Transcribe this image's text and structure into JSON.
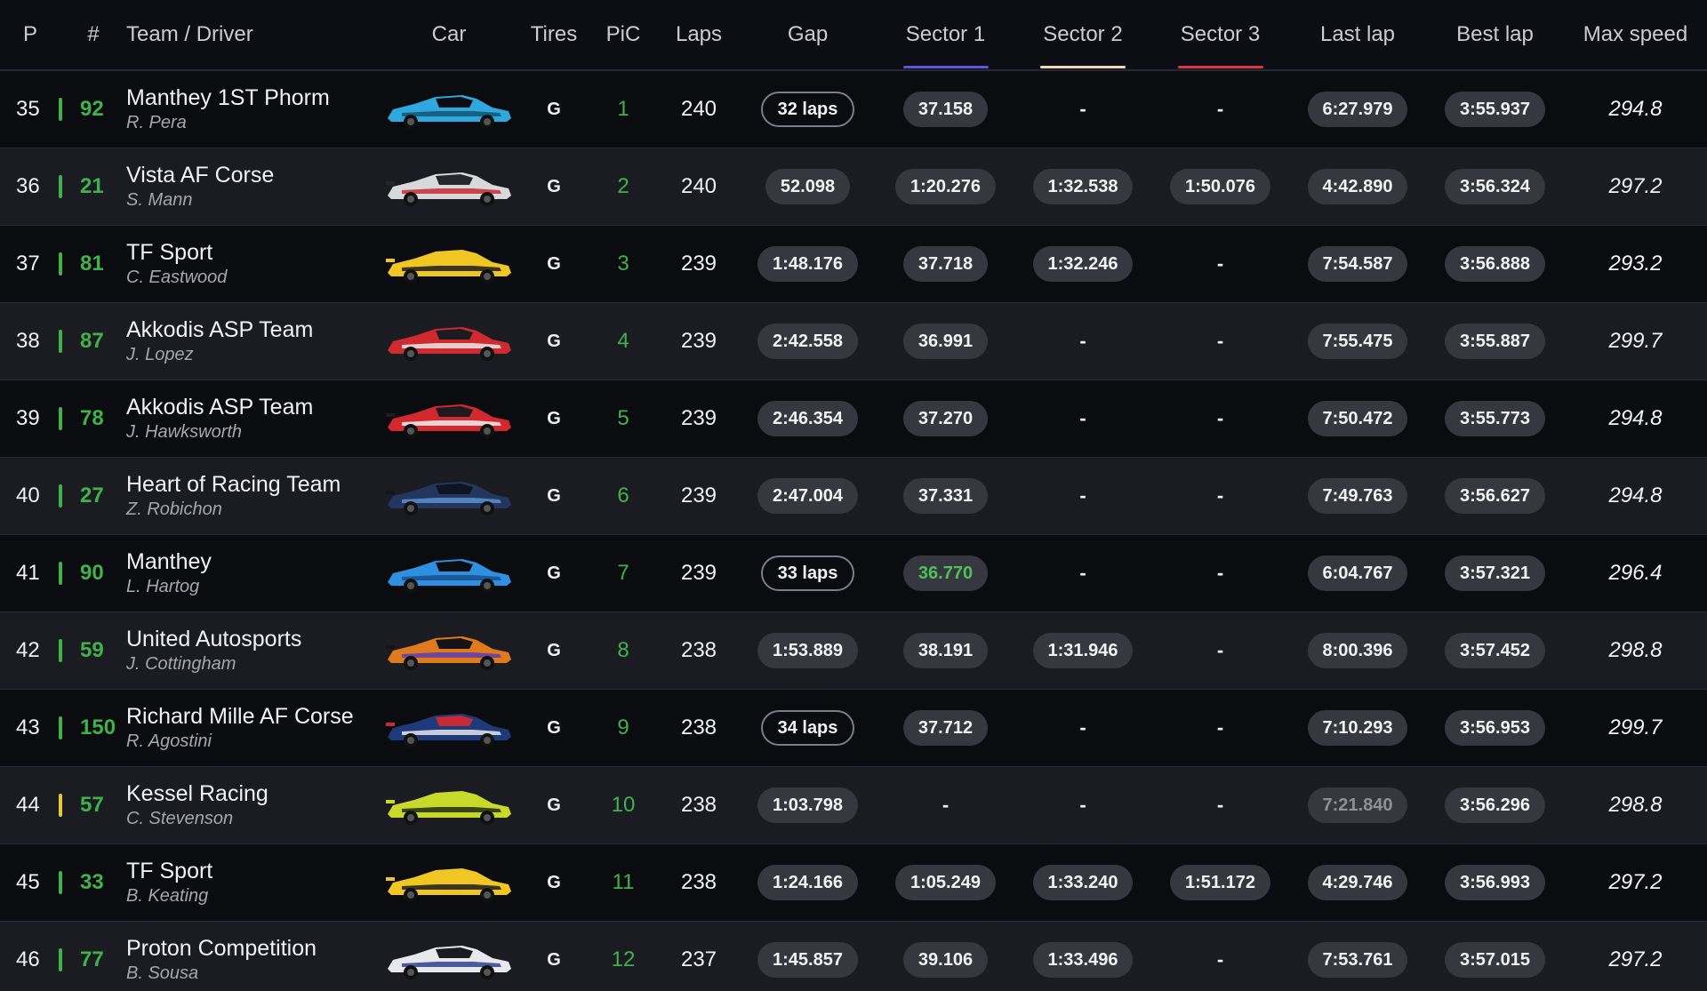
{
  "colors": {
    "sector1": "#5a58e0",
    "sector2": "#f1d5bd",
    "sector3": "#e0344a",
    "class_green": "#3fb24a",
    "class_yellow": "#e8c53a"
  },
  "headers": {
    "pos": "P",
    "num": "#",
    "team": "Team / Driver",
    "car": "Car",
    "tires": "Tires",
    "pic": "PiC",
    "laps": "Laps",
    "gap": "Gap",
    "s1": "Sector 1",
    "s2": "Sector 2",
    "s3": "Sector 3",
    "last": "Last lap",
    "best": "Best lap",
    "max": "Max speed"
  },
  "rows": [
    {
      "pos": "35",
      "num": "92",
      "team": "Manthey 1ST Phorm",
      "driver": "R. Pera",
      "tires": "G",
      "pic": "1",
      "laps": "240",
      "gap": "32 laps",
      "gap_style": "outline",
      "s1": "37.158",
      "s1_style": "pill",
      "s2": "-",
      "s2_style": "dash",
      "s3": "-",
      "s3_style": "dash",
      "last": "6:27.979",
      "last_style": "pill",
      "best": "3:55.937",
      "max": "294.8",
      "class_color": "green",
      "car_colors": [
        "#2fa8e0",
        "#14546e",
        "#0c0d12"
      ]
    },
    {
      "pos": "36",
      "num": "21",
      "team": "Vista AF Corse",
      "driver": "S. Mann",
      "tires": "G",
      "pic": "2",
      "laps": "240",
      "gap": "52.098",
      "gap_style": "pill",
      "s1": "1:20.276",
      "s1_style": "pill",
      "s2": "1:32.538",
      "s2_style": "pill",
      "s3": "1:50.076",
      "s3_style": "pill",
      "last": "4:42.890",
      "last_style": "pill",
      "best": "3:56.324",
      "max": "297.2",
      "class_color": "green",
      "car_colors": [
        "#d9d9dc",
        "#c62a34",
        "#26272c"
      ]
    },
    {
      "pos": "37",
      "num": "81",
      "team": "TF Sport",
      "driver": "C. Eastwood",
      "tires": "G",
      "pic": "3",
      "laps": "239",
      "gap": "1:48.176",
      "gap_style": "pill",
      "s1": "37.718",
      "s1_style": "pill",
      "s2": "1:32.246",
      "s2_style": "pill",
      "s3": "-",
      "s3_style": "dash",
      "last": "7:54.587",
      "last_style": "pill",
      "best": "3:56.888",
      "max": "293.2",
      "class_color": "green",
      "car_colors": [
        "#f0c623",
        "#1b1b1e",
        "#f0c623"
      ]
    },
    {
      "pos": "38",
      "num": "87",
      "team": "Akkodis ASP Team",
      "driver": "J. Lopez",
      "tires": "G",
      "pic": "4",
      "laps": "239",
      "gap": "2:42.558",
      "gap_style": "pill",
      "s1": "36.991",
      "s1_style": "pill",
      "s2": "-",
      "s2_style": "dash",
      "s3": "-",
      "s3_style": "dash",
      "last": "7:55.475",
      "last_style": "pill",
      "best": "3:55.887",
      "max": "299.7",
      "class_color": "green",
      "car_colors": [
        "#cf2a30",
        "#eaeaea",
        "#1c1c20"
      ]
    },
    {
      "pos": "39",
      "num": "78",
      "team": "Akkodis ASP Team",
      "driver": "J. Hawksworth",
      "tires": "G",
      "pic": "5",
      "laps": "239",
      "gap": "2:46.354",
      "gap_style": "pill",
      "s1": "37.270",
      "s1_style": "pill",
      "s2": "-",
      "s2_style": "dash",
      "s3": "-",
      "s3_style": "dash",
      "last": "7:50.472",
      "last_style": "pill",
      "best": "3:55.773",
      "max": "294.8",
      "class_color": "green",
      "car_colors": [
        "#d2282e",
        "#f0f0f0",
        "#1c1c20"
      ]
    },
    {
      "pos": "40",
      "num": "27",
      "team": "Heart of Racing Team",
      "driver": "Z. Robichon",
      "tires": "G",
      "pic": "6",
      "laps": "239",
      "gap": "2:47.004",
      "gap_style": "pill",
      "s1": "37.331",
      "s1_style": "pill",
      "s2": "-",
      "s2_style": "dash",
      "s3": "-",
      "s3_style": "dash",
      "last": "7:49.763",
      "last_style": "pill",
      "best": "3:56.627",
      "max": "294.8",
      "class_color": "green",
      "car_colors": [
        "#23365e",
        "#5a8fd1",
        "#0f1424"
      ]
    },
    {
      "pos": "41",
      "num": "90",
      "team": "Manthey",
      "driver": "L. Hartog",
      "tires": "G",
      "pic": "7",
      "laps": "239",
      "gap": "33 laps",
      "gap_style": "outline",
      "s1": "36.770",
      "s1_style": "best",
      "s2": "-",
      "s2_style": "dash",
      "s3": "-",
      "s3_style": "dash",
      "last": "6:04.767",
      "last_style": "pill",
      "best": "3:57.321",
      "max": "296.4",
      "class_color": "green",
      "car_colors": [
        "#2f8fe0",
        "#1a4f8c",
        "#0c0d12"
      ]
    },
    {
      "pos": "42",
      "num": "59",
      "team": "United Autosports",
      "driver": "J. Cottingham",
      "tires": "G",
      "pic": "8",
      "laps": "238",
      "gap": "1:53.889",
      "gap_style": "pill",
      "s1": "38.191",
      "s1_style": "pill",
      "s2": "1:31.946",
      "s2_style": "pill",
      "s3": "-",
      "s3_style": "dash",
      "last": "8:00.396",
      "last_style": "pill",
      "best": "3:57.452",
      "max": "298.8",
      "class_color": "green",
      "car_colors": [
        "#e07a1f",
        "#5a3fb0",
        "#141418"
      ]
    },
    {
      "pos": "43",
      "num": "150",
      "team": "Richard Mille AF Corse",
      "driver": "R. Agostini",
      "tires": "G",
      "pic": "9",
      "laps": "238",
      "gap": "34 laps",
      "gap_style": "outline",
      "s1": "37.712",
      "s1_style": "pill",
      "s2": "-",
      "s2_style": "dash",
      "s3": "-",
      "s3_style": "dash",
      "last": "7:10.293",
      "last_style": "pill",
      "best": "3:56.953",
      "max": "299.7",
      "class_color": "green",
      "car_colors": [
        "#1f3a7a",
        "#e8e8ea",
        "#c62a34"
      ]
    },
    {
      "pos": "44",
      "num": "57",
      "team": "Kessel Racing",
      "driver": "C. Stevenson",
      "tires": "G",
      "pic": "10",
      "laps": "238",
      "gap": "1:03.798",
      "gap_style": "pill",
      "s1": "-",
      "s1_style": "dash",
      "s2": "-",
      "s2_style": "dash",
      "s3": "-",
      "s3_style": "dash",
      "last": "7:21.840",
      "last_style": "dim",
      "best": "3:56.296",
      "max": "298.8",
      "class_color": "yellow",
      "car_colors": [
        "#c8d92a",
        "#1e2a14",
        "#c8d92a"
      ]
    },
    {
      "pos": "45",
      "num": "33",
      "team": "TF Sport",
      "driver": "B. Keating",
      "tires": "G",
      "pic": "11",
      "laps": "238",
      "gap": "1:24.166",
      "gap_style": "pill",
      "s1": "1:05.249",
      "s1_style": "pill",
      "s2": "1:33.240",
      "s2_style": "pill",
      "s3": "1:51.172",
      "s3_style": "pill",
      "last": "4:29.746",
      "last_style": "pill",
      "best": "3:56.993",
      "max": "297.2",
      "class_color": "green",
      "car_colors": [
        "#f0c623",
        "#1b1b1e",
        "#f0c623"
      ]
    },
    {
      "pos": "46",
      "num": "77",
      "team": "Proton Competition",
      "driver": "B. Sousa",
      "tires": "G",
      "pic": "12",
      "laps": "237",
      "gap": "1:45.857",
      "gap_style": "pill",
      "s1": "39.106",
      "s1_style": "pill",
      "s2": "1:33.496",
      "s2_style": "pill",
      "s3": "-",
      "s3_style": "dash",
      "last": "7:53.761",
      "last_style": "pill",
      "best": "3:57.015",
      "max": "297.2",
      "class_color": "green",
      "car_colors": [
        "#e8e8ec",
        "#2f3f8f",
        "#1a1a20"
      ]
    }
  ]
}
